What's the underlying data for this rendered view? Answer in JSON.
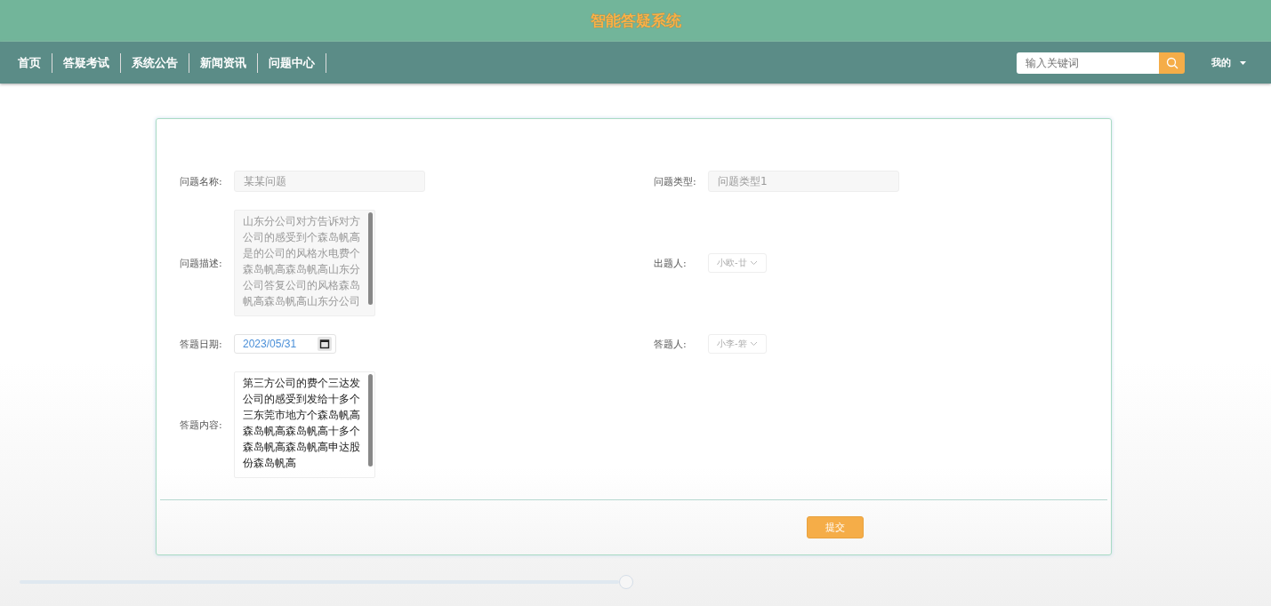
{
  "header": {
    "title": "智能答疑系统"
  },
  "nav": {
    "items": [
      {
        "label": "首页"
      },
      {
        "label": "答疑考试"
      },
      {
        "label": "系统公告"
      },
      {
        "label": "新闻资讯"
      },
      {
        "label": "问题中心"
      }
    ],
    "search": {
      "placeholder": "输入关键词"
    },
    "user_menu": "我的"
  },
  "form": {
    "rows": [
      {
        "left": {
          "kind": "input",
          "label": "问题名称:",
          "value": "某某问题"
        },
        "right": {
          "kind": "input",
          "label": "问题类型:",
          "value": "问题类型1"
        }
      },
      {
        "left": {
          "kind": "textarea",
          "label": "问题描述:",
          "value": "山东分公司对方告诉对方公司的感受到个森岛帆高是的公司的风格水电费个森岛帆高森岛帆高山东分公司答复公司的风格森岛帆高森岛帆高山东分公司",
          "disabled": true
        },
        "right": {
          "kind": "select",
          "label": "出题人:",
          "value": "小欧-廿"
        }
      },
      {
        "left": {
          "kind": "date",
          "label": "答题日期:",
          "value": "2023/05/31"
        },
        "right": {
          "kind": "select",
          "label": "答题人:",
          "value": "小李-箬"
        }
      },
      {
        "left": {
          "kind": "textarea",
          "label": "答题内容:",
          "value": "第三方公司的费个三达发公司的感受到发给十多个三东莞市地方个森岛帆高森岛帆高森岛帆高十多个森岛帆高森岛帆高申达股份森岛帆高",
          "disabled": false
        }
      }
    ],
    "submit": "提交"
  },
  "page_slider": {
    "level": 1
  }
}
